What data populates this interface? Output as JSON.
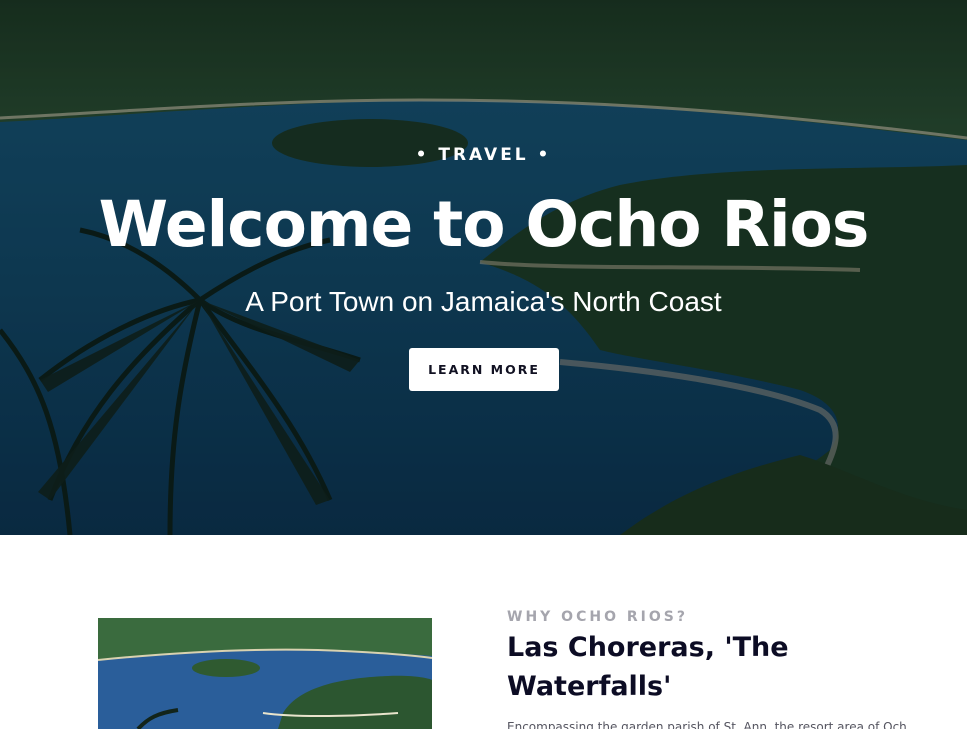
{
  "hero": {
    "eyebrow": "• TRAVEL •",
    "title": "Welcome to Ocho Rios",
    "subtitle": "A Port Town on Jamaica's North Coast",
    "cta_label": "LEARN MORE"
  },
  "feature": {
    "eyebrow": "WHY OCHO RIOS?",
    "title": "Las Choreras, 'The Waterfalls'",
    "body": "Encompassing the garden parish of St. Ann, the resort area of Ocho"
  }
}
